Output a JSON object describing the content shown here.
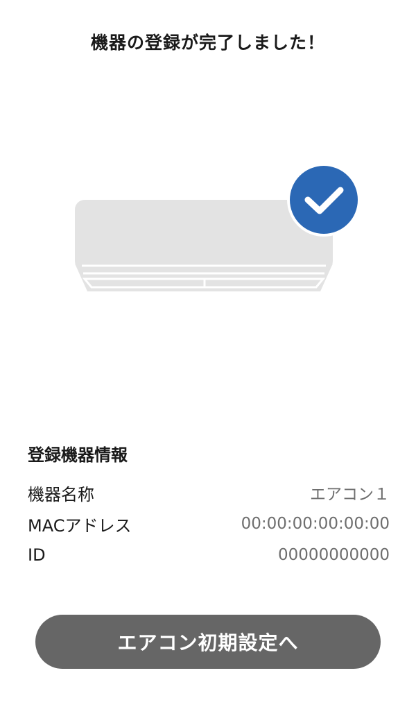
{
  "header": {
    "title": "機器の登録が完了しました！"
  },
  "illustration": {
    "device_icon": "air-conditioner-icon",
    "status_icon": "check-badge-icon",
    "check_color": "#2b68b5",
    "device_color": "#e3e3e3"
  },
  "device_info": {
    "section_title": "登録機器情報",
    "rows": [
      {
        "label": "機器名称",
        "value": "エアコン１"
      },
      {
        "label": "MACアドレス",
        "value": "00:00:00:00:00:00"
      },
      {
        "label": "ID",
        "value": "00000000000"
      }
    ]
  },
  "actions": {
    "primary_label": "エアコン初期設定へ",
    "primary_color": "#666666"
  }
}
